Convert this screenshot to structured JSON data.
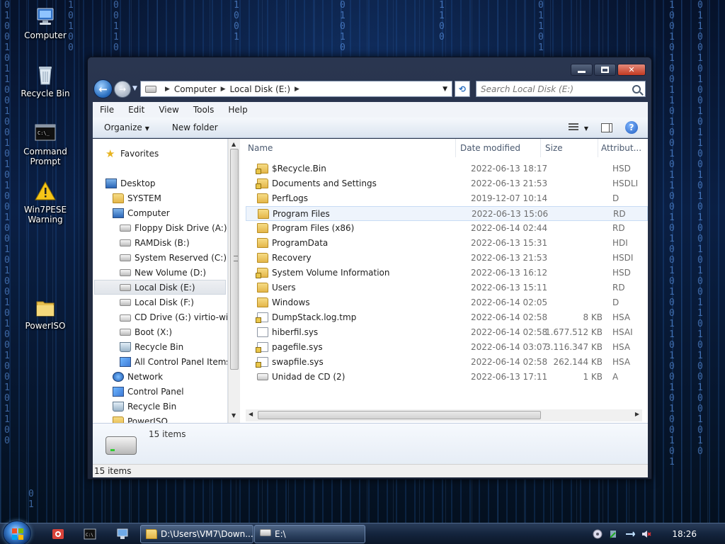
{
  "desktop": {
    "icons": [
      {
        "label": "Computer",
        "icon": "computer-icon"
      },
      {
        "label": "Recycle Bin",
        "icon": "recycle-bin-icon"
      },
      {
        "label": "Command Prompt",
        "icon": "command-prompt-icon"
      },
      {
        "label": "Win7PESE Warning",
        "icon": "warning-icon"
      },
      {
        "label": "PowerISO",
        "icon": "folder-icon"
      }
    ]
  },
  "window": {
    "address": {
      "crumbs": [
        "Computer",
        "Local Disk (E:)"
      ]
    },
    "search_placeholder": "Search Local Disk (E:)",
    "menu": [
      "File",
      "Edit",
      "View",
      "Tools",
      "Help"
    ],
    "toolbar": {
      "organize": "Organize",
      "new_folder": "New folder"
    },
    "nav": {
      "favorites": "Favorites",
      "desktop": "Desktop",
      "system": "SYSTEM",
      "computer": "Computer",
      "drives": [
        "Floppy Disk Drive (A:)",
        "RAMDisk (B:)",
        "System Reserved (C:)",
        "New Volume (D:)",
        "Local Disk (E:)",
        "Local Disk (F:)",
        "CD Drive (G:) virtio-win-",
        "Boot (X:)",
        "Recycle Bin",
        "All Control Panel Items"
      ],
      "network": "Network",
      "control_panel": "Control Panel",
      "recycle_bin": "Recycle Bin",
      "poweriso": "PowerISO"
    },
    "columns": {
      "name": "Name",
      "date": "Date modified",
      "size": "Size",
      "attr": "Attribut..."
    },
    "files": [
      {
        "name": "$Recycle.Bin",
        "date": "2022-06-13 18:17",
        "size": "",
        "attr": "HSD",
        "kind": "folder-locked"
      },
      {
        "name": "Documents and Settings",
        "date": "2022-06-13 21:53",
        "size": "",
        "attr": "HSDLI",
        "kind": "folder-locked"
      },
      {
        "name": "PerfLogs",
        "date": "2019-12-07 10:14",
        "size": "",
        "attr": "D",
        "kind": "folder"
      },
      {
        "name": "Program Files",
        "date": "2022-06-13 15:06",
        "size": "",
        "attr": "RD",
        "kind": "folder"
      },
      {
        "name": "Program Files (x86)",
        "date": "2022-06-14 02:44",
        "size": "",
        "attr": "RD",
        "kind": "folder"
      },
      {
        "name": "ProgramData",
        "date": "2022-06-13 15:31",
        "size": "",
        "attr": "HDI",
        "kind": "folder"
      },
      {
        "name": "Recovery",
        "date": "2022-06-13 21:53",
        "size": "",
        "attr": "HSDI",
        "kind": "folder"
      },
      {
        "name": "System Volume Information",
        "date": "2022-06-13 16:12",
        "size": "",
        "attr": "HSD",
        "kind": "folder-locked"
      },
      {
        "name": "Users",
        "date": "2022-06-13 15:11",
        "size": "",
        "attr": "RD",
        "kind": "folder"
      },
      {
        "name": "Windows",
        "date": "2022-06-14 02:05",
        "size": "",
        "attr": "D",
        "kind": "folder"
      },
      {
        "name": "DumpStack.log.tmp",
        "date": "2022-06-14 02:58",
        "size": "8 KB",
        "attr": "HSA",
        "kind": "file-locked"
      },
      {
        "name": "hiberfil.sys",
        "date": "2022-06-14 02:58",
        "size": "1.677.512 KB",
        "attr": "HSAI",
        "kind": "file"
      },
      {
        "name": "pagefile.sys",
        "date": "2022-06-14 03:07",
        "size": "3.116.347 KB",
        "attr": "HSA",
        "kind": "file-locked"
      },
      {
        "name": "swapfile.sys",
        "date": "2022-06-14 02:58",
        "size": "262.144 KB",
        "attr": "HSA",
        "kind": "file-locked"
      },
      {
        "name": "Unidad de CD (2)",
        "date": "2022-06-13 17:11",
        "size": "1 KB",
        "attr": "A",
        "kind": "cd"
      }
    ],
    "details_count": "15 items",
    "status": "15 items"
  },
  "taskbar": {
    "tasks": [
      {
        "label": "D:\\Users\\VM7\\Down...",
        "icon": "folder-icon"
      },
      {
        "label": "E:\\",
        "icon": "drive-icon"
      }
    ],
    "clock": "18:26"
  }
}
